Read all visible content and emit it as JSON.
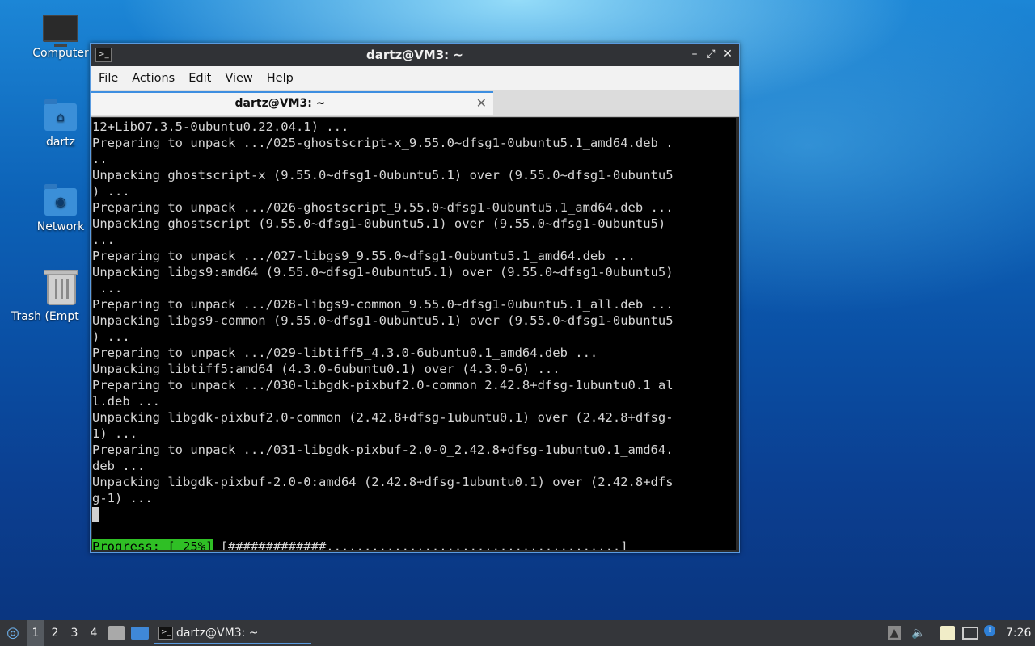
{
  "desktop": {
    "icons": [
      {
        "label": "Computer"
      },
      {
        "label": "dartz"
      },
      {
        "label": "Network"
      },
      {
        "label": "Trash (Empt"
      }
    ]
  },
  "window": {
    "title": "dartz@VM3: ~",
    "controls": {
      "minimize": "–",
      "maximize": "⤢",
      "close": "✕"
    },
    "menu": [
      "File",
      "Actions",
      "Edit",
      "View",
      "Help"
    ],
    "tab": {
      "label": "dartz@VM3: ~",
      "close": "✕"
    }
  },
  "terminal": {
    "lines": [
      "12+LibO7.3.5-0ubuntu0.22.04.1) ...",
      "Preparing to unpack .../025-ghostscript-x_9.55.0~dfsg1-0ubuntu5.1_amd64.deb .",
      "..",
      "Unpacking ghostscript-x (9.55.0~dfsg1-0ubuntu5.1) over (9.55.0~dfsg1-0ubuntu5",
      ") ...",
      "Preparing to unpack .../026-ghostscript_9.55.0~dfsg1-0ubuntu5.1_amd64.deb ...",
      "Unpacking ghostscript (9.55.0~dfsg1-0ubuntu5.1) over (9.55.0~dfsg1-0ubuntu5)",
      "...",
      "Preparing to unpack .../027-libgs9_9.55.0~dfsg1-0ubuntu5.1_amd64.deb ...",
      "Unpacking libgs9:amd64 (9.55.0~dfsg1-0ubuntu5.1) over (9.55.0~dfsg1-0ubuntu5)",
      " ...",
      "Preparing to unpack .../028-libgs9-common_9.55.0~dfsg1-0ubuntu5.1_all.deb ...",
      "Unpacking libgs9-common (9.55.0~dfsg1-0ubuntu5.1) over (9.55.0~dfsg1-0ubuntu5",
      ") ...",
      "Preparing to unpack .../029-libtiff5_4.3.0-6ubuntu0.1_amd64.deb ...",
      "Unpacking libtiff5:amd64 (4.3.0-6ubuntu0.1) over (4.3.0-6) ...",
      "Preparing to unpack .../030-libgdk-pixbuf2.0-common_2.42.8+dfsg-1ubuntu0.1_al",
      "l.deb ...",
      "Unpacking libgdk-pixbuf2.0-common (2.42.8+dfsg-1ubuntu0.1) over (2.42.8+dfsg-",
      "1) ...",
      "Preparing to unpack .../031-libgdk-pixbuf-2.0-0_2.42.8+dfsg-1ubuntu0.1_amd64.",
      "deb ...",
      "Unpacking libgdk-pixbuf-2.0-0:amd64 (2.42.8+dfsg-1ubuntu0.1) over (2.42.8+dfs",
      "g-1) ..."
    ],
    "progress": {
      "label": "Progress: [ 25%]",
      "bar": " [#############.......................................]",
      "percent": 25
    }
  },
  "taskbar": {
    "workspaces": [
      "1",
      "2",
      "3",
      "4"
    ],
    "active_workspace": "1",
    "task_label": "dartz@VM3: ~",
    "clock": "7:26"
  },
  "colors": {
    "accent": "#3d8ee0",
    "progress_green": "#2fbf25",
    "terminal_bg": "#000000"
  }
}
